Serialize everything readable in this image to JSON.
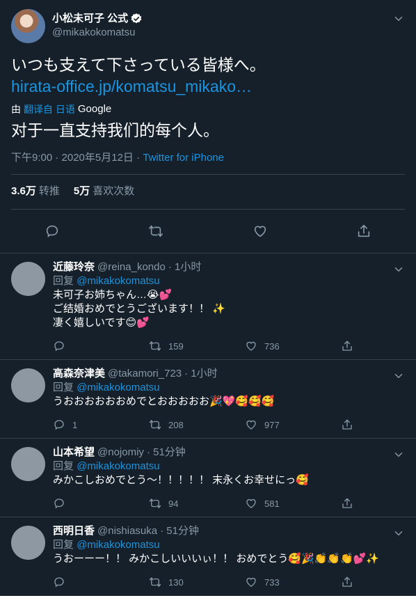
{
  "main_tweet": {
    "author_name": "小松未可子 公式",
    "handle": "@mikakokomatsu",
    "text": "いつも支えて下さっている皆様へ。",
    "link": "hirata-office.jp/komatsu_mikako…",
    "translate_prefix": "由",
    "translate_label": "翻译自 日语",
    "translate_provider": "Google",
    "translated_text": "对于一直支持我们的每个人。",
    "meta": "下午9:00 · 2020年5月12日 · ",
    "source": "Twitter for iPhone",
    "stats": {
      "retweets_count": "3.6万",
      "retweets_label": "转推",
      "likes_count": "5万",
      "likes_label": "喜欢次数"
    }
  },
  "replies": [
    {
      "name": "近藤玲奈",
      "handle": "@reina_kondo",
      "time": "· 1小时",
      "replying_prefix": "回复",
      "replying_to": "@mikakokomatsu",
      "text": "未可子お姉ちゃん…😭💕\nご结婚おめでとうございます！！ ✨\n凄く嬉しいです😊💕",
      "replies_count": "",
      "retweets_count": "159",
      "likes_count": "736"
    },
    {
      "name": "高森奈津美",
      "handle": "@takamori_723",
      "time": "· 1小时",
      "replying_prefix": "回复",
      "replying_to": "@mikakokomatsu",
      "text": "うおおおおおおめでとおおおおお🎉💖🥰🥰🥰",
      "replies_count": "1",
      "retweets_count": "208",
      "likes_count": "977"
    },
    {
      "name": "山本希望",
      "handle": "@nojomiy",
      "time": "· 51分钟",
      "replying_prefix": "回复",
      "replying_to": "@mikakokomatsu",
      "text": "みかこしおめでとう〜！！！！！ 末永くお幸せにっ🥰",
      "replies_count": "",
      "retweets_count": "94",
      "likes_count": "581"
    },
    {
      "name": "西明日香",
      "handle": "@nishiasuka",
      "time": "· 51分钟",
      "replying_prefix": "回复",
      "replying_to": "@mikakokomatsu",
      "text": "うおーーー！！ みかこしいいいぃ！！ おめでとう🥰🎉👏👏👏💕✨",
      "replies_count": "",
      "retweets_count": "130",
      "likes_count": "733"
    }
  ],
  "icons": {
    "verified": "verified-badge-icon",
    "chevron": "chevron-down-icon",
    "reply": "reply-icon",
    "retweet": "retweet-icon",
    "like": "heart-icon",
    "share": "share-icon"
  },
  "colors": {
    "background": "#15202b",
    "link": "#1b95e0",
    "muted": "#8899a6",
    "divider": "#38444d"
  }
}
